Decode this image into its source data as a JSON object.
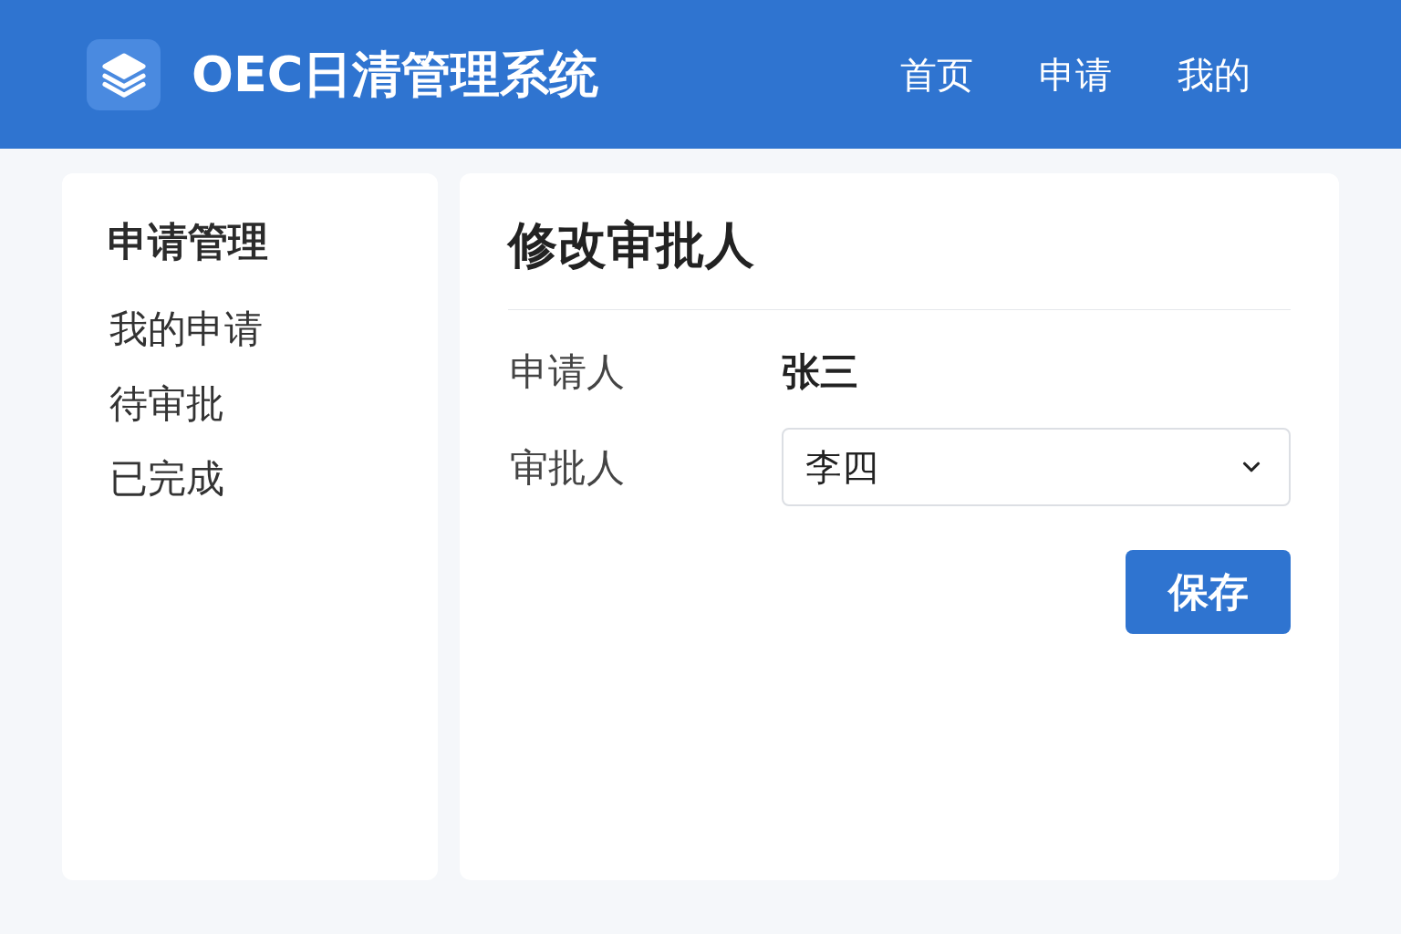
{
  "header": {
    "title": "OEC日清管理系统",
    "nav": [
      "首页",
      "申请",
      "我的"
    ]
  },
  "sidebar": {
    "title": "申请管理",
    "items": [
      "我的申请",
      "待审批",
      "已完成"
    ]
  },
  "form": {
    "title": "修改审批人",
    "fields": [
      {
        "kind": "text",
        "label": "申请人",
        "value": "张三"
      },
      {
        "kind": "select",
        "label": "审批人",
        "value": "李四"
      }
    ],
    "button": "保存"
  }
}
